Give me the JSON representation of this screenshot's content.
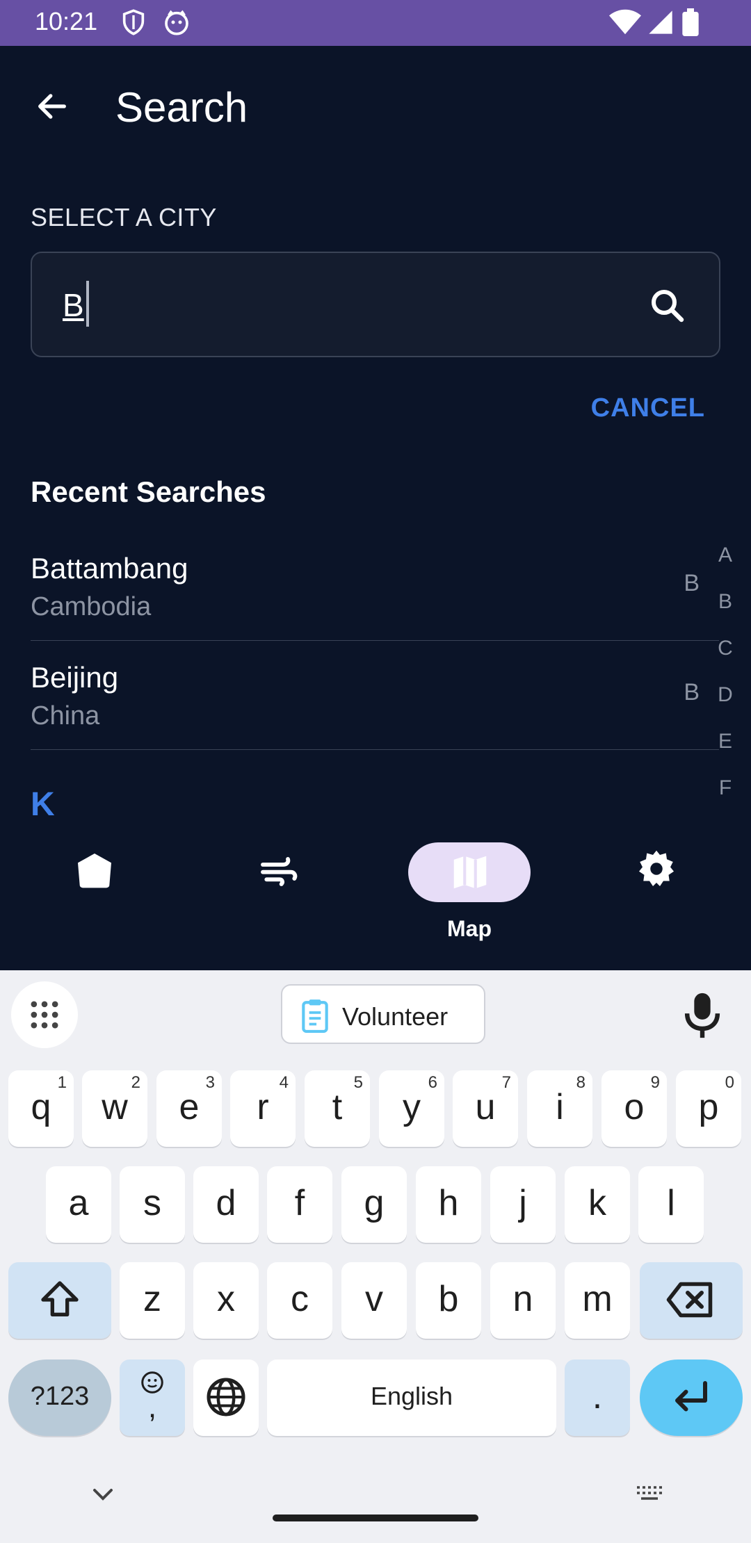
{
  "status_bar": {
    "time": "10:21",
    "icons": [
      "shield-icon",
      "cat-face-icon",
      "wifi-icon",
      "signal-icon",
      "battery-icon"
    ],
    "background": "#6750a4"
  },
  "header": {
    "title": "Search",
    "back_icon": "arrow-back-icon"
  },
  "search": {
    "section_label": "SELECT A CITY",
    "value": "B",
    "icon": "search-icon",
    "cancel_label": "CANCEL"
  },
  "recent": {
    "title": "Recent Searches",
    "items": [
      {
        "city": "Battambang",
        "country": "Cambodia",
        "letter": "B"
      },
      {
        "city": "Beijing",
        "country": "China",
        "letter": "B"
      }
    ],
    "next_section_header": "K"
  },
  "alpha_index": [
    "A",
    "B",
    "C",
    "D",
    "E",
    "F"
  ],
  "bottom_nav": {
    "items": [
      {
        "icon": "home-icon",
        "label": ""
      },
      {
        "icon": "wind-icon",
        "label": ""
      },
      {
        "icon": "map-icon",
        "label": "Map",
        "active": true
      },
      {
        "icon": "gear-icon",
        "label": ""
      }
    ]
  },
  "keyboard": {
    "suggestion": "Volunteer",
    "row1": [
      {
        "key": "q",
        "hint": "1"
      },
      {
        "key": "w",
        "hint": "2"
      },
      {
        "key": "e",
        "hint": "3"
      },
      {
        "key": "r",
        "hint": "4"
      },
      {
        "key": "t",
        "hint": "5"
      },
      {
        "key": "y",
        "hint": "6"
      },
      {
        "key": "u",
        "hint": "7"
      },
      {
        "key": "i",
        "hint": "8"
      },
      {
        "key": "o",
        "hint": "9"
      },
      {
        "key": "p",
        "hint": "0"
      }
    ],
    "row2": [
      "a",
      "s",
      "d",
      "f",
      "g",
      "h",
      "j",
      "k",
      "l"
    ],
    "row3": [
      "z",
      "x",
      "c",
      "v",
      "b",
      "n",
      "m"
    ],
    "symbols_label": "?123",
    "emoji_comma": ",",
    "space_label": "English",
    "period_label": "."
  },
  "colors": {
    "app_background": "#0b1428",
    "accent_blue": "#3f7fe8",
    "nav_pill": "#e7ddf7",
    "enter_key": "#5ec8f5"
  }
}
